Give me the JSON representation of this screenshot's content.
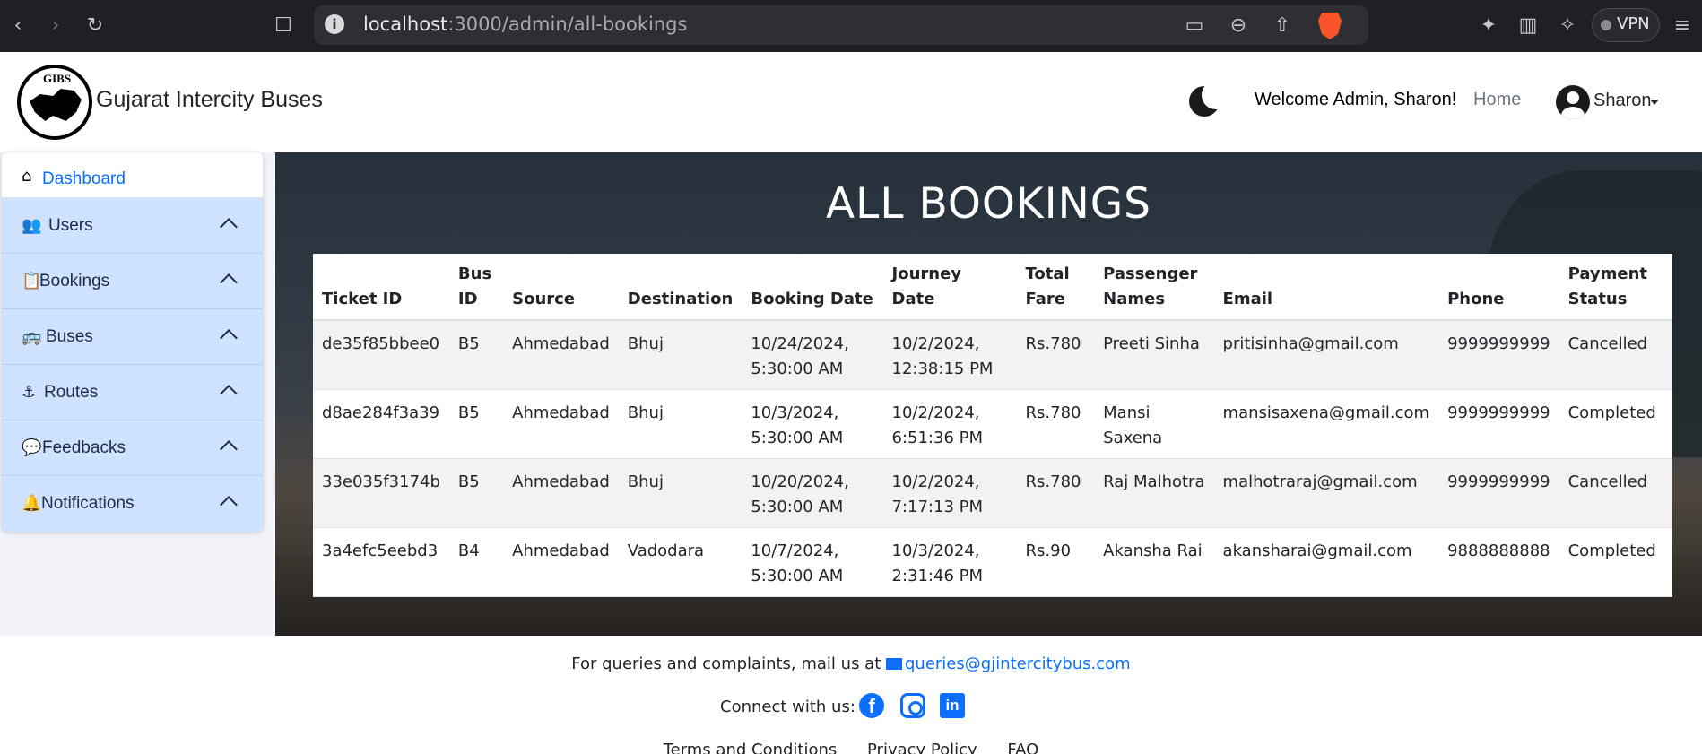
{
  "browser": {
    "url_host": "localhost",
    "url_path": ":3000/admin/all-bookings",
    "vpn_label": "VPN"
  },
  "navbar": {
    "logo_text": "GIBS",
    "brand": "Gujarat Intercity Buses",
    "welcome": "Welcome Admin, Sharon!",
    "home": "Home",
    "user": "Sharon"
  },
  "sidebar": {
    "dashboard": "Dashboard",
    "items": [
      {
        "label": "Users",
        "icon": "users-icon"
      },
      {
        "label": "Bookings",
        "icon": "clipboard-icon"
      },
      {
        "label": "Buses",
        "icon": "bus-icon"
      },
      {
        "label": "Routes",
        "icon": "route-icon"
      },
      {
        "label": "Feedbacks",
        "icon": "comment-icon"
      },
      {
        "label": "Notifications",
        "icon": "bell-icon"
      }
    ]
  },
  "page": {
    "title": "ALL BOOKINGS"
  },
  "table": {
    "headers": [
      "Ticket ID",
      "Bus ID",
      "Source",
      "Destination",
      "Booking Date",
      "Journey Date",
      "Total Fare",
      "Passenger Names",
      "Email",
      "Phone",
      "Payment Status"
    ],
    "rows": [
      [
        "de35f85bbee0",
        "B5",
        "Ahmedabad",
        "Bhuj",
        "10/24/2024, 5:30:00 AM",
        "10/2/2024, 12:38:15 PM",
        "Rs.780",
        "Preeti Sinha",
        "pritisinha@gmail.com",
        "9999999999",
        "Cancelled"
      ],
      [
        "d8ae284f3a39",
        "B5",
        "Ahmedabad",
        "Bhuj",
        "10/3/2024, 5:30:00 AM",
        "10/2/2024, 6:51:36 PM",
        "Rs.780",
        "Mansi Saxena",
        "mansisaxena@gmail.com",
        "9999999999",
        "Completed"
      ],
      [
        "33e035f3174b",
        "B5",
        "Ahmedabad",
        "Bhuj",
        "10/20/2024, 5:30:00 AM",
        "10/2/2024, 7:17:13 PM",
        "Rs.780",
        "Raj Malhotra",
        "malhotraraj@gmail.com",
        "9999999999",
        "Cancelled"
      ],
      [
        "3a4efc5eebd3",
        "B4",
        "Ahmedabad",
        "Vadodara",
        "10/7/2024, 5:30:00 AM",
        "10/3/2024, 2:31:46 PM",
        "Rs.90",
        "Akansha Rai",
        "akansharai@gmail.com",
        "9888888888",
        "Completed"
      ]
    ]
  },
  "footer": {
    "query_text": "For queries and complaints, mail us at",
    "email": "queries@gjintercitybus.com",
    "connect": "Connect with us:",
    "links": [
      "Terms and Conditions",
      "Privacy Policy",
      "FAQ"
    ]
  },
  "colors": {
    "accent": "#0d6efd",
    "sidebar_bg": "#cfe2ff"
  }
}
